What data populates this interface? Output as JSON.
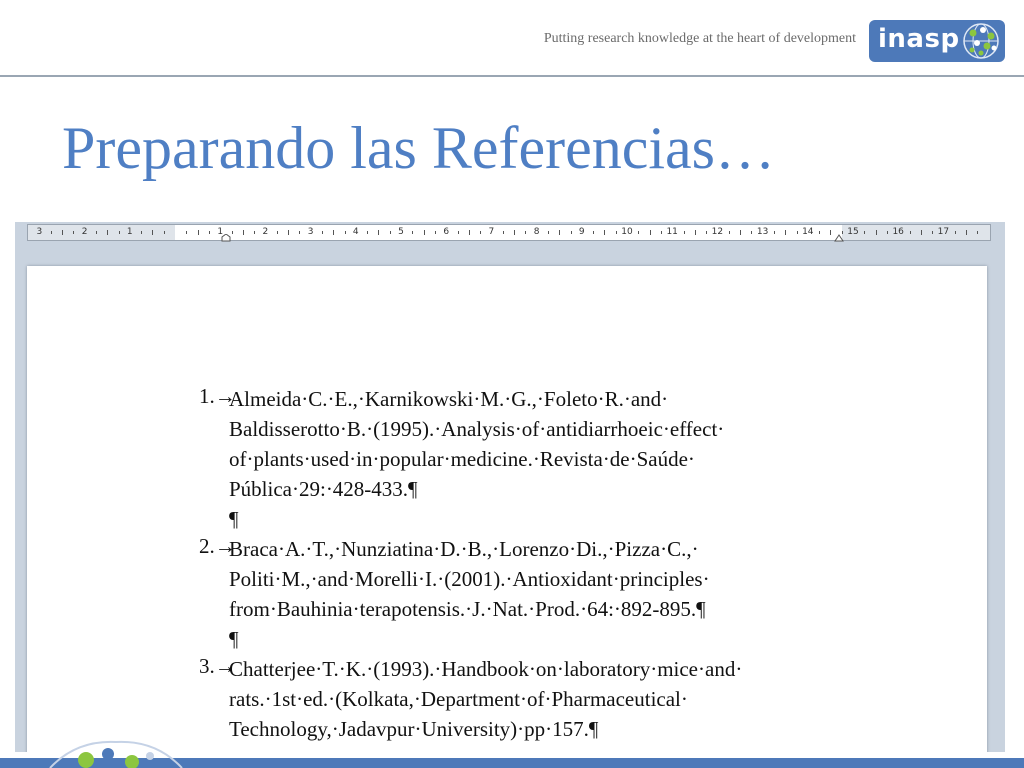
{
  "header": {
    "tagline": "Putting research knowledge at the heart of development",
    "logo_text": "inasp"
  },
  "slide": {
    "title": "Preparando las Referencias…"
  },
  "ruler": {
    "left_labels": [
      "3",
      "2",
      "1"
    ],
    "right_labels": [
      "1",
      "2",
      "3",
      "4",
      "5",
      "6",
      "7",
      "8",
      "9",
      "10",
      "11",
      "12",
      "13",
      "14",
      "15",
      "16",
      "17"
    ]
  },
  "document": {
    "references": [
      {
        "number": "1.→",
        "lines": [
          "Almeida·C.·E.,·Karnikowski·M.·G.,·Foleto·R.·and·",
          "Baldisserotto·B.·(1995).·Analysis·of·antidiarrhoeic·effect·",
          "of·plants·used·in·popular·medicine.·Revista·de·Saúde·",
          "Pública·29:·428-433.¶"
        ],
        "trailing": "¶"
      },
      {
        "number": "2.→",
        "lines": [
          "Braca·A.·T.,·Nunziatina·D.·B.,·Lorenzo·Di.,·Pizza·C.,·",
          "Politi·M.,·and·Morelli·I.·(2001).·Antioxidant·principles·",
          "from·Bauhinia·terapotensis.·J.·Nat.·Prod.·64:·892-895.¶"
        ],
        "trailing": "¶"
      },
      {
        "number": "3.→",
        "lines": [
          "Chatterjee·T.·K.·(1993).·Handbook·on·laboratory·mice·and·",
          "rats.·1st·ed.·(Kolkata,·Department·of·Pharmaceutical·",
          "Technology,·Jadavpur·University)·pp·157.¶"
        ],
        "trailing": ""
      }
    ]
  },
  "colors": {
    "title": "#4f7fc4",
    "brand": "#4d79b9",
    "logo_green": "#8cc63f"
  }
}
